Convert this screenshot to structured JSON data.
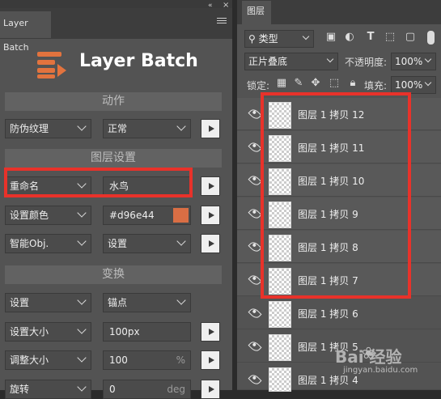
{
  "left_panel": {
    "tab_title": "Layer Batch",
    "logo_title": "Layer Batch",
    "collapse_icon": "«",
    "close_icon": "×",
    "sections": {
      "action": "动作",
      "layer_settings": "图层设置",
      "transform": "变换"
    },
    "rows": [
      {
        "dropdown": "防伪纹理",
        "value": "正常",
        "value_type": "dropdown"
      },
      {
        "dropdown": "重命名",
        "value": "水鸟",
        "value_type": "text"
      },
      {
        "dropdown": "设置颜色",
        "value": "#d96e44",
        "value_type": "color"
      },
      {
        "dropdown": "智能Obj.",
        "value": "设置",
        "value_type": "dropdown"
      },
      {
        "dropdown": "设置",
        "value": "锚点",
        "value_type": "dropdown"
      },
      {
        "dropdown": "设置大小",
        "value": "100px",
        "value_type": "text"
      },
      {
        "dropdown": "调整大小",
        "value": "100",
        "unit": "%",
        "value_type": "text"
      },
      {
        "dropdown": "旋转",
        "value": "0",
        "unit": "deg",
        "value_type": "text"
      }
    ],
    "swatch_color": "#d96e44",
    "logo_color": "#e2733e"
  },
  "right_panel": {
    "tab_title": "图层",
    "filter_label": "类型",
    "blend_mode": "正片叠底",
    "opacity_label": "不透明度:",
    "opacity_value": "100%",
    "lock_label": "锁定:",
    "fill_label": "填充:",
    "fill_value": "100%",
    "layers": [
      "图层 1 拷贝 12",
      "图层 1 拷贝 11",
      "图层 1 拷贝 10",
      "图层 1 拷贝 9",
      "图层 1 拷贝 8",
      "图层 1 拷贝 7",
      "图层 1 拷贝 6",
      "图层 1 拷贝 5",
      "图层 1 拷贝 4"
    ]
  },
  "watermark": {
    "text": "Bai  经验",
    "url": "jingyan.baidu.com"
  },
  "highlight_color": "#e8322a"
}
